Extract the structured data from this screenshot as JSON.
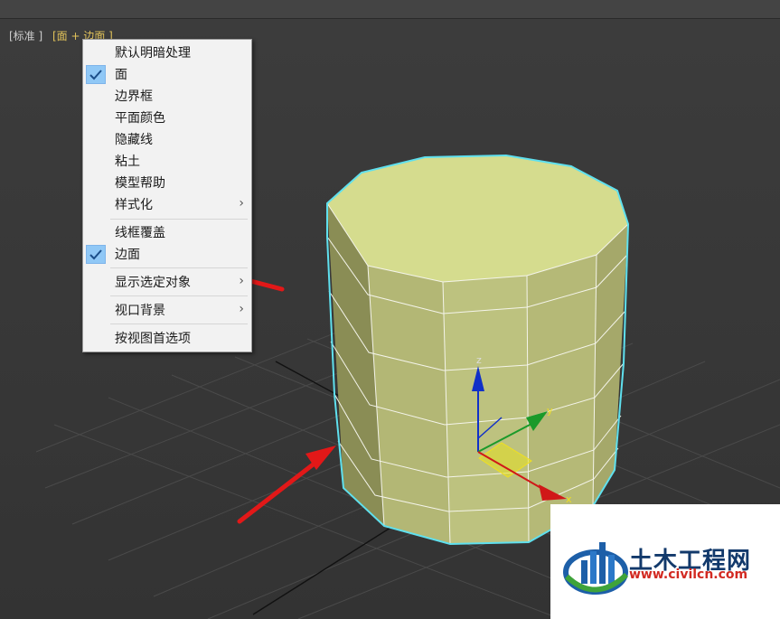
{
  "viewport": {
    "label_standard": "[标准 ]",
    "label_mode": "[面 + 边面 ]"
  },
  "menu": {
    "items": [
      {
        "label": "默认明暗处理",
        "checked": false,
        "submenu": false
      },
      {
        "label": "面",
        "checked": true,
        "submenu": false
      },
      {
        "label": "边界框",
        "checked": false,
        "submenu": false
      },
      {
        "label": "平面颜色",
        "checked": false,
        "submenu": false
      },
      {
        "label": "隐藏线",
        "checked": false,
        "submenu": false
      },
      {
        "label": "粘土",
        "checked": false,
        "submenu": false
      },
      {
        "label": "模型帮助",
        "checked": false,
        "submenu": false
      },
      {
        "label": "样式化",
        "checked": false,
        "submenu": true
      },
      {
        "label": "线框覆盖",
        "checked": false,
        "submenu": false
      },
      {
        "label": "边面",
        "checked": true,
        "submenu": false
      },
      {
        "label": "显示选定对象",
        "checked": false,
        "submenu": true
      },
      {
        "label": "视口背景",
        "checked": false,
        "submenu": true
      },
      {
        "label": "按视图首选项",
        "checked": false,
        "submenu": false
      }
    ],
    "submenu_glyph": "›",
    "check_icon": "checkmark-icon"
  },
  "gizmo": {
    "axis_z": "z",
    "axis_y": "y",
    "axis_x": "x",
    "colors": {
      "z": "#1030c8",
      "y": "#1a9a2a",
      "x": "#d01818",
      "plane": "#e6e020"
    }
  },
  "colors": {
    "cylinder_top": "#d5dc8e",
    "cylinder_side": "#bcc17c",
    "selection_outline": "#5fe0ee",
    "annotation_arrow": "#e21818",
    "menu_bg": "#f2f2f2",
    "check_bg": "#90c8f6"
  },
  "watermark": {
    "title": "土木工程网",
    "url": "www.civilcn.com"
  }
}
